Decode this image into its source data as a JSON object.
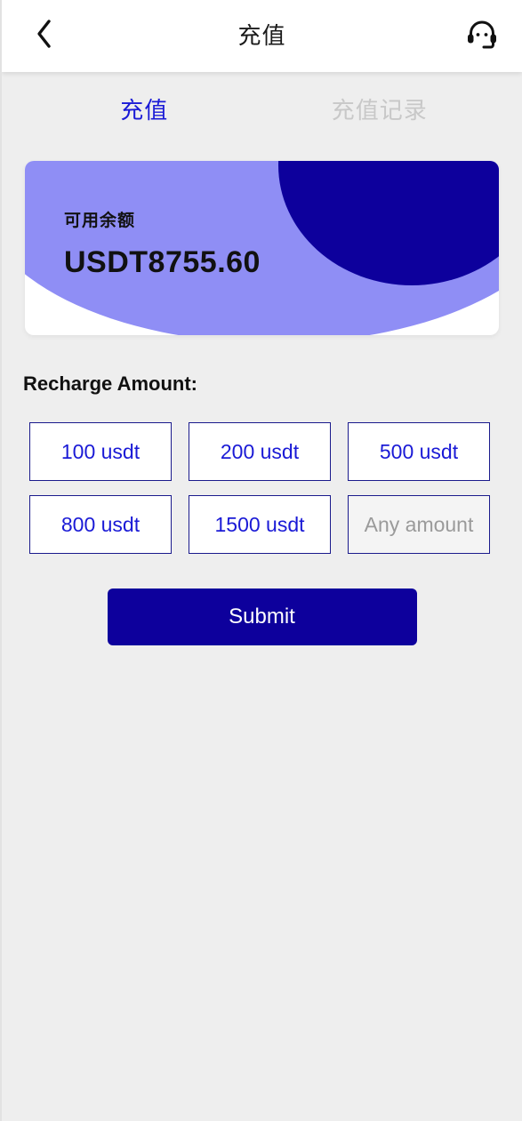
{
  "header": {
    "title": "充值",
    "back_icon": "chevron-left-icon",
    "service_icon": "headset-icon"
  },
  "tabs": [
    {
      "label": "充值",
      "active": true
    },
    {
      "label": "充值记录",
      "active": false
    }
  ],
  "balance_card": {
    "label": "可用余额",
    "value": "USDT8755.60"
  },
  "recharge": {
    "section_label": "Recharge Amount:",
    "options": [
      {
        "label": "100 usdt"
      },
      {
        "label": "200 usdt"
      },
      {
        "label": "500 usdt"
      },
      {
        "label": "800 usdt"
      },
      {
        "label": "1500 usdt"
      }
    ],
    "custom_input": {
      "placeholder": "Any amount",
      "value": ""
    },
    "submit_label": "Submit"
  },
  "colors": {
    "page_background": "#eeeeee",
    "navy": "#0d009c",
    "accent_blue": "#1a1ad6",
    "light_purple": "#8f8ef5",
    "tab_inactive": "#c8c8c8",
    "card_white": "#ffffff",
    "input_fill": "#f4f4f4",
    "placeholder_gray": "#9a9a9a"
  }
}
